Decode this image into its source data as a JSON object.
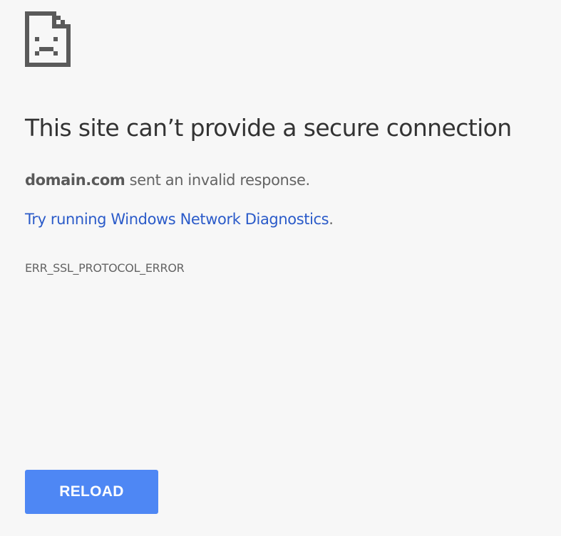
{
  "error_page": {
    "icon": "sad-page-icon",
    "title": "This site can’t provide a secure connection",
    "message": {
      "domain": "domain.com",
      "text": " sent an invalid response."
    },
    "suggestion": {
      "link_label": "Try running Windows Network Diagnostics",
      "suffix": "."
    },
    "error_code": "ERR_SSL_PROTOCOL_ERROR",
    "reload_label": "RELOAD"
  },
  "colors": {
    "background": "#f7f7f7",
    "title": "#333333",
    "body_text": "#646464",
    "link": "#2b5bc9",
    "button": "#4e87f4",
    "button_text": "#ffffff",
    "icon": "#5a5a5a"
  }
}
